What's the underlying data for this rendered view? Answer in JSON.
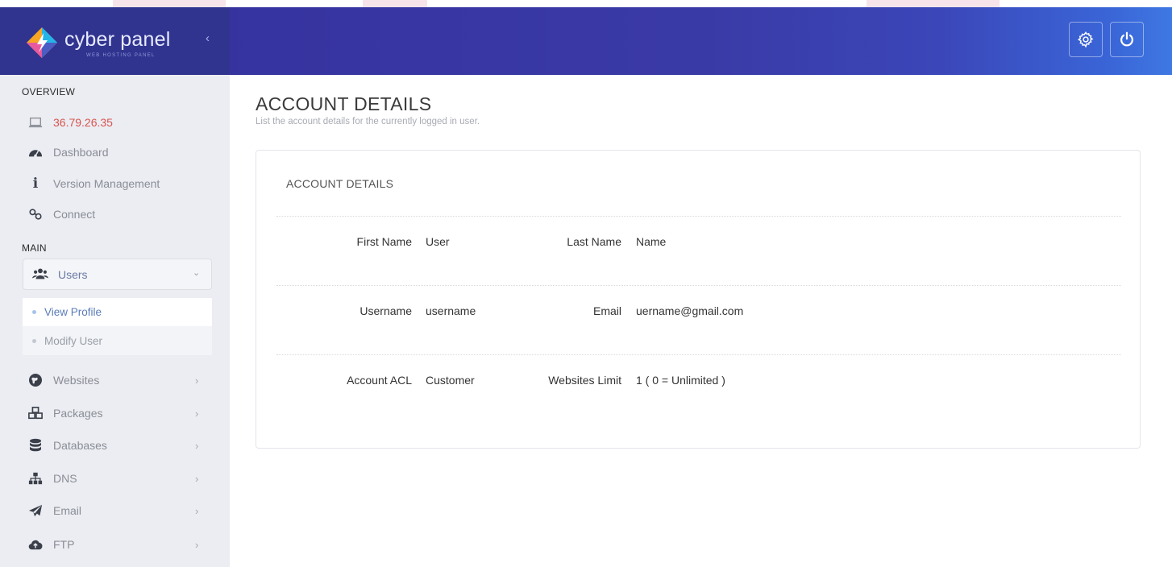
{
  "app": {
    "brand_name": "cyber panel",
    "brand_sub": "WEB HOSTING PANEL",
    "collapse_glyph": "‹",
    "colors": {
      "header_start": "#34309c",
      "header_end": "#3f78e2",
      "sidebar_bg": "#ebedf2",
      "ip_color": "#d9534f"
    }
  },
  "header": {
    "icons": [
      "gear-icon",
      "power-icon"
    ]
  },
  "sidebar": {
    "overview_label": "OVERVIEW",
    "overview_items": [
      {
        "icon": "laptop-icon",
        "label": "36.79.26.35"
      },
      {
        "icon": "dashboard-icon",
        "label": "Dashboard"
      },
      {
        "icon": "info-icon",
        "label": "Version Management"
      },
      {
        "icon": "link-icon",
        "label": "Connect"
      }
    ],
    "main_label": "MAIN",
    "users": {
      "icon": "users-icon",
      "label": "Users",
      "chevron": "⌄"
    },
    "users_sub": [
      {
        "label": "View Profile",
        "active": true
      },
      {
        "label": "Modify User",
        "active": false
      }
    ],
    "main_items": [
      {
        "icon": "globe-icon",
        "label": "Websites",
        "arrow": "›"
      },
      {
        "icon": "cubes-icon",
        "label": "Packages",
        "arrow": "›"
      },
      {
        "icon": "database-icon",
        "label": "Databases",
        "arrow": "›"
      },
      {
        "icon": "sitemap-icon",
        "label": "DNS",
        "arrow": "›"
      },
      {
        "icon": "paper-plane-icon",
        "label": "Email",
        "arrow": "›"
      },
      {
        "icon": "cloud-upload-icon",
        "label": "FTP",
        "arrow": "›"
      }
    ]
  },
  "main": {
    "title": "ACCOUNT DETAILS",
    "description": "List the account details for the currently logged in user.",
    "panel_title": "ACCOUNT DETAILS",
    "rows": [
      {
        "label1": "First Name",
        "value1": "User",
        "label2": "Last Name",
        "value2": "Name"
      },
      {
        "label1": "Username",
        "value1": "username",
        "label2": "Email",
        "value2": "uername@gmail.com"
      },
      {
        "label1": "Account ACL",
        "value1": "Customer",
        "label2": "Websites Limit",
        "value2": "1 ( 0 = Unlimited )"
      }
    ]
  }
}
